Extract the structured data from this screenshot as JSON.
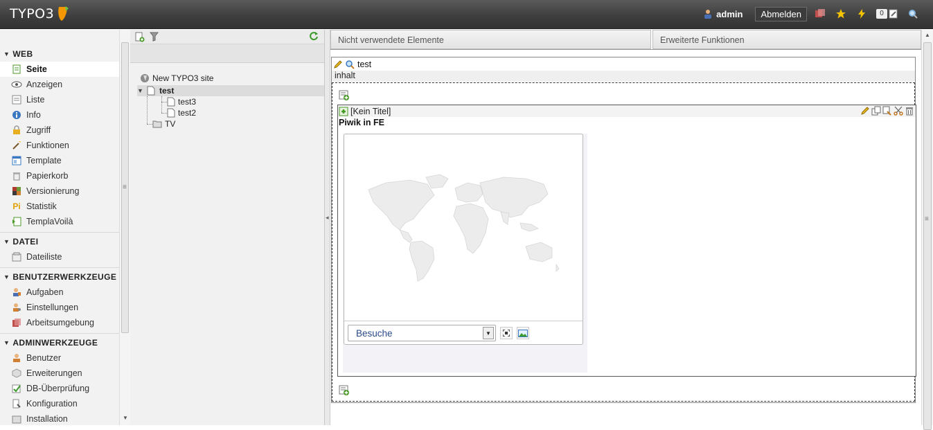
{
  "topbar": {
    "logo_text": "TYPO3",
    "username": "admin",
    "logout_label": "Abmelden",
    "cache_count": "0"
  },
  "module_menu": {
    "groups": [
      {
        "title": "WEB",
        "items": [
          {
            "label": "Seite",
            "icon": "page-icon"
          },
          {
            "label": "Anzeigen",
            "icon": "eye-icon"
          },
          {
            "label": "Liste",
            "icon": "list-icon"
          },
          {
            "label": "Info",
            "icon": "info-icon"
          },
          {
            "label": "Zugriff",
            "icon": "lock-icon"
          },
          {
            "label": "Funktionen",
            "icon": "wand-icon"
          },
          {
            "label": "Template",
            "icon": "template-icon"
          },
          {
            "label": "Papierkorb",
            "icon": "trash-icon"
          },
          {
            "label": "Versionierung",
            "icon": "versioning-icon"
          },
          {
            "label": "Statistik",
            "icon": "piwik-icon"
          },
          {
            "label": "TemplaVoilà",
            "icon": "templavoila-icon"
          }
        ]
      },
      {
        "title": "DATEI",
        "items": [
          {
            "label": "Dateiliste",
            "icon": "filelist-icon"
          }
        ]
      },
      {
        "title": "BENUTZERWERKZEUGE",
        "items": [
          {
            "label": "Aufgaben",
            "icon": "tasks-icon"
          },
          {
            "label": "Einstellungen",
            "icon": "user-settings-icon"
          },
          {
            "label": "Arbeitsumgebung",
            "icon": "workspace-icon"
          }
        ]
      },
      {
        "title": "ADMINWERKZEUGE",
        "items": [
          {
            "label": "Benutzer",
            "icon": "user-icon"
          },
          {
            "label": "Erweiterungen",
            "icon": "extension-icon"
          },
          {
            "label": "DB-Überprüfung",
            "icon": "db-check-icon"
          },
          {
            "label": "Konfiguration",
            "icon": "config-icon"
          },
          {
            "label": "Installation",
            "icon": "install-icon"
          }
        ]
      }
    ]
  },
  "page_tree": {
    "root": "New TYPO3 site",
    "selected": "test",
    "children": [
      "test3",
      "test2"
    ],
    "folder": "TV"
  },
  "content": {
    "tabs": [
      "Nicht verwendete Elemente",
      "Erweiterte Funktionen"
    ],
    "page_title": "test",
    "column_label": "inhalt",
    "ce_title": "[Kein Titel]",
    "ce_type": "Piwik in FE",
    "metric_selected": "Besuche"
  },
  "colors": {
    "topbar": "#3d3d3d",
    "typo3_orange": "#f49700",
    "metric_text": "#2a4a8a"
  }
}
